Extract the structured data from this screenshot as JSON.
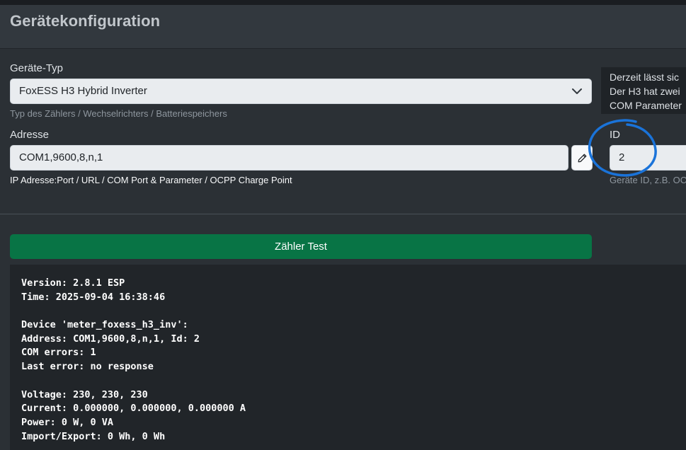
{
  "header": {
    "title": "Gerätekonfiguration"
  },
  "device_type": {
    "label": "Geräte-Typ",
    "selected": "FoxESS H3 Hybrid Inverter",
    "help": "Typ des Zählers / Wechselrichters / Batteriespeichers"
  },
  "tooltip": {
    "lines": [
      "Derzeit lässt sic",
      "Der H3 hat zwei",
      "COM Parameter"
    ]
  },
  "address": {
    "label": "Adresse",
    "value": "COM1,9600,8,n,1",
    "help": "IP Adresse:Port / URL / COM Port & Parameter / OCPP Charge Point",
    "edit_icon": "pencil-icon"
  },
  "id": {
    "label": "ID",
    "value": "2",
    "help": "Geräte ID, z.B. OC"
  },
  "test_button": {
    "label": "Zähler Test"
  },
  "console": {
    "lines": [
      "Version: 2.8.1 ESP",
      "Time: 2025-09-04 16:38:46",
      "",
      "Device 'meter_foxess_h3_inv':",
      "Address: COM1,9600,8,n,1, Id: 2",
      "COM errors: 1",
      "Last error: no response",
      "",
      "Voltage: 230, 230, 230",
      "Current: 0.000000, 0.000000, 0.000000 A",
      "Power: 0 W, 0 VA",
      "Import/Export: 0 Wh, 0 Wh"
    ]
  },
  "colors": {
    "background": "#2b3035",
    "button_green": "#087445",
    "annotation_blue": "#1a73d9"
  }
}
